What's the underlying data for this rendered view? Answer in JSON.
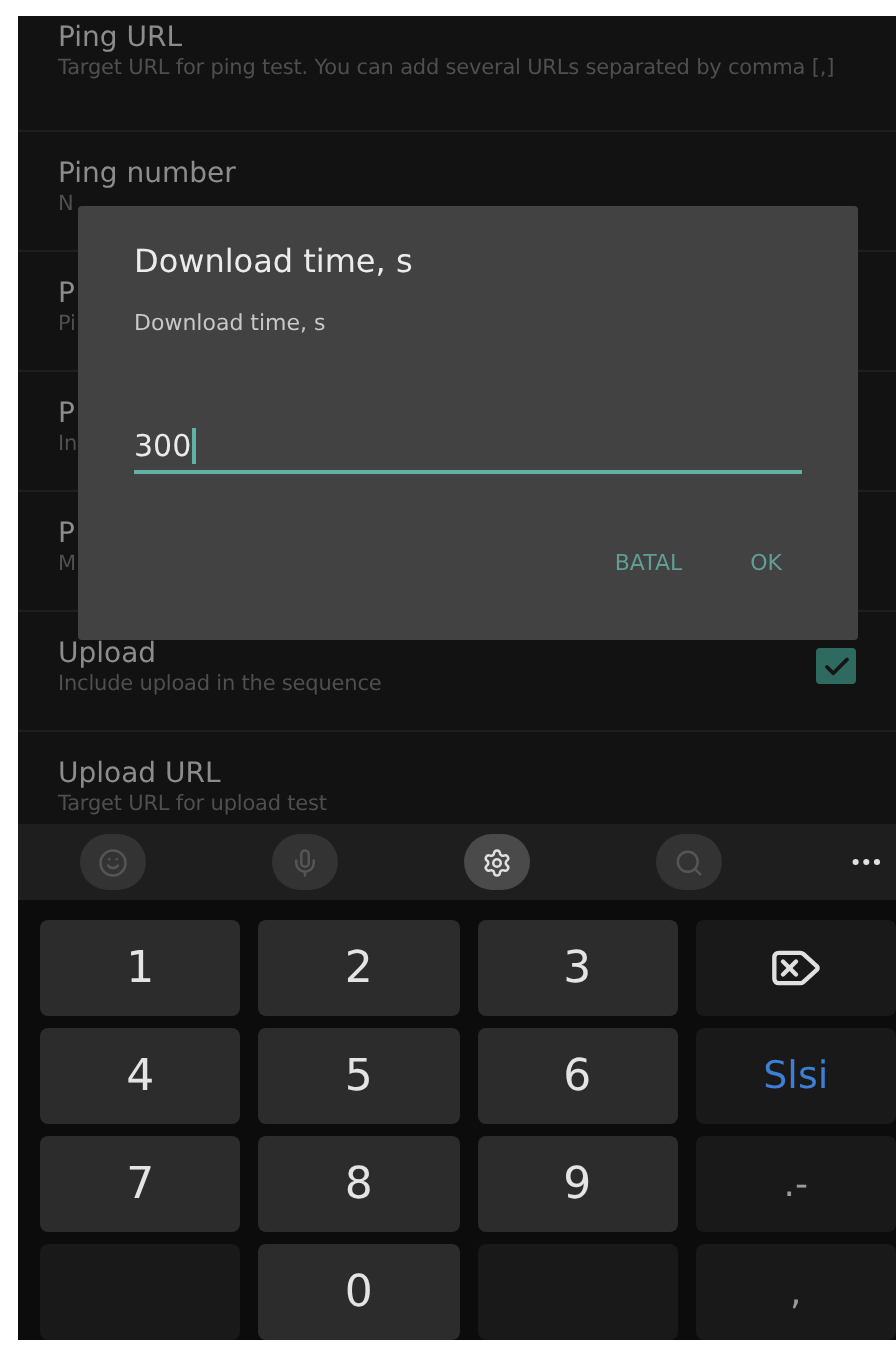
{
  "settings": [
    {
      "kind": "text",
      "title": "Ping URL",
      "subtitle": "Target URL for ping test. You can add several URLs separated by comma [,]"
    },
    {
      "kind": "text",
      "title": "Ping number",
      "subtitle": "N"
    },
    {
      "kind": "text",
      "title": "P",
      "subtitle": "Pi"
    },
    {
      "kind": "text",
      "title": "P",
      "subtitle": "In"
    },
    {
      "kind": "text",
      "title": "P",
      "subtitle": "M"
    },
    {
      "kind": "checkbox",
      "title": "Upload",
      "subtitle": "Include upload in the sequence",
      "checked": true
    },
    {
      "kind": "text",
      "title": "Upload URL",
      "subtitle": "Target URL for upload test"
    }
  ],
  "dialog": {
    "title": "Download time, s",
    "label": "Download time, s",
    "value": "300",
    "buttons": [
      "BATAL",
      "OK"
    ]
  },
  "keyboard": {
    "toolbar": [
      {
        "kind": "emoji",
        "disabled": true
      },
      {
        "kind": "mic",
        "disabled": true
      },
      {
        "kind": "settings",
        "disabled": false
      },
      {
        "kind": "search",
        "disabled": true
      },
      {
        "kind": "more"
      }
    ],
    "keys": [
      {
        "kind": "digit",
        "label": "1"
      },
      {
        "kind": "digit",
        "label": "2"
      },
      {
        "kind": "digit",
        "label": "3"
      },
      {
        "kind": "backspace"
      },
      {
        "kind": "digit",
        "label": "4"
      },
      {
        "kind": "digit",
        "label": "5"
      },
      {
        "kind": "digit",
        "label": "6"
      },
      {
        "kind": "action",
        "label": "Slsi"
      },
      {
        "kind": "digit",
        "label": "7"
      },
      {
        "kind": "digit",
        "label": "8"
      },
      {
        "kind": "digit",
        "label": "9"
      },
      {
        "kind": "symbol",
        "label": ".-"
      },
      {
        "kind": "blank"
      },
      {
        "kind": "digit",
        "label": "0"
      },
      {
        "kind": "blank"
      },
      {
        "kind": "symbol",
        "label": ","
      }
    ]
  }
}
